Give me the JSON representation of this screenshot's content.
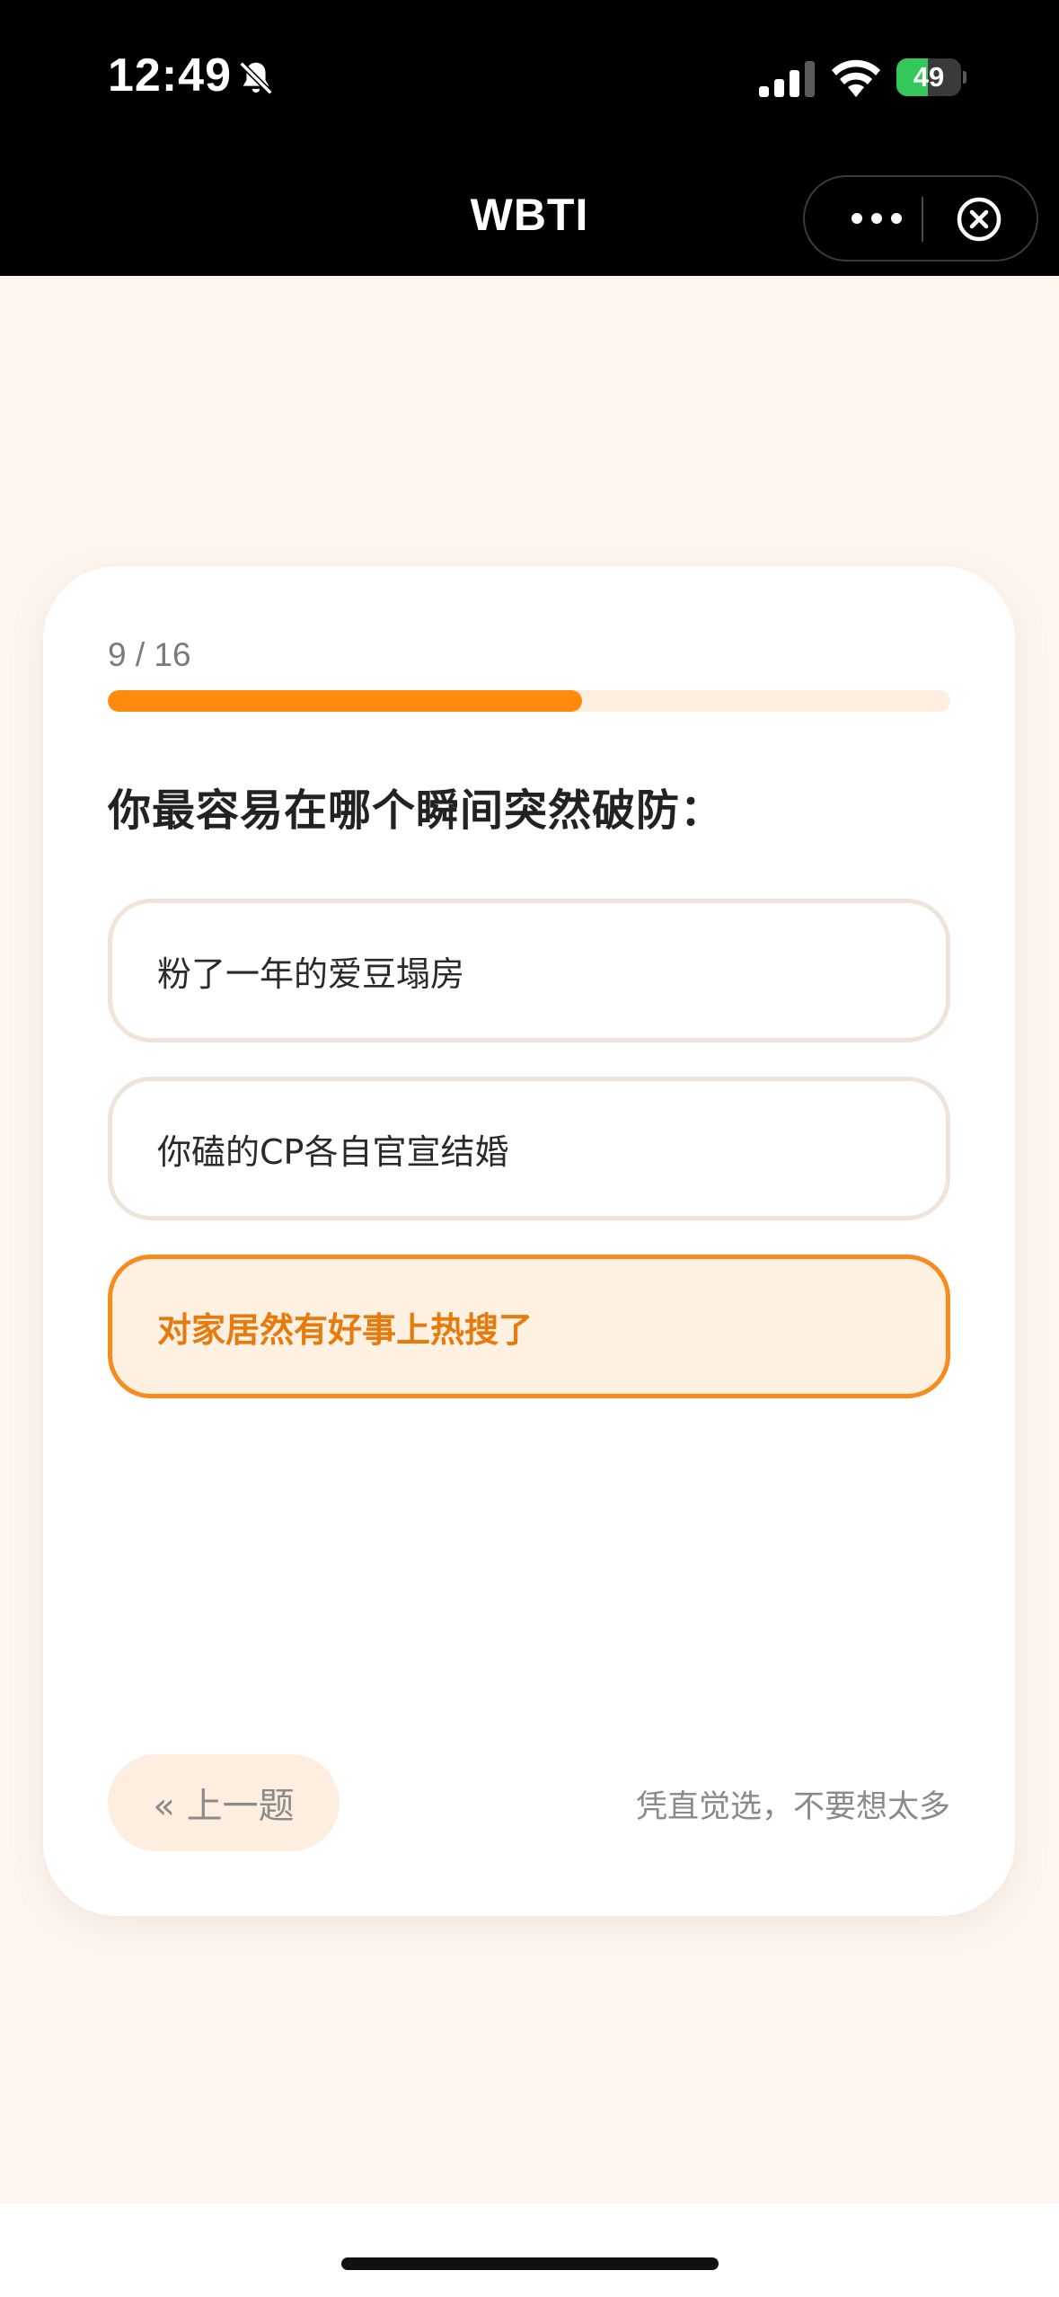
{
  "status_bar": {
    "time": "12:49",
    "battery": "49",
    "battery_level": 0.49,
    "icons": [
      "bell-slash-icon",
      "signal-icon",
      "wifi-icon",
      "battery-charging-icon"
    ]
  },
  "nav": {
    "title": "WBTI",
    "icons": [
      "more-icon",
      "close-circle-icon"
    ]
  },
  "quiz": {
    "progress_label": "9 / 16",
    "progress_value": 0.5625,
    "question": "你最容易在哪个瞬间突然破防：",
    "options": [
      {
        "label": "粉了一年的爱豆塌房",
        "selected": false
      },
      {
        "label": "你磕的CP各自官宣结婚",
        "selected": false
      },
      {
        "label": "对家居然有好事上热搜了",
        "selected": true
      }
    ],
    "prev_button": "« 上一题",
    "hint": "凭直觉选，不要想太多"
  },
  "colors": {
    "accent": "#ff8a0e",
    "accent_light": "#fff1e2",
    "page_bg": "#fdf6f0",
    "battery_green": "#34c759"
  }
}
